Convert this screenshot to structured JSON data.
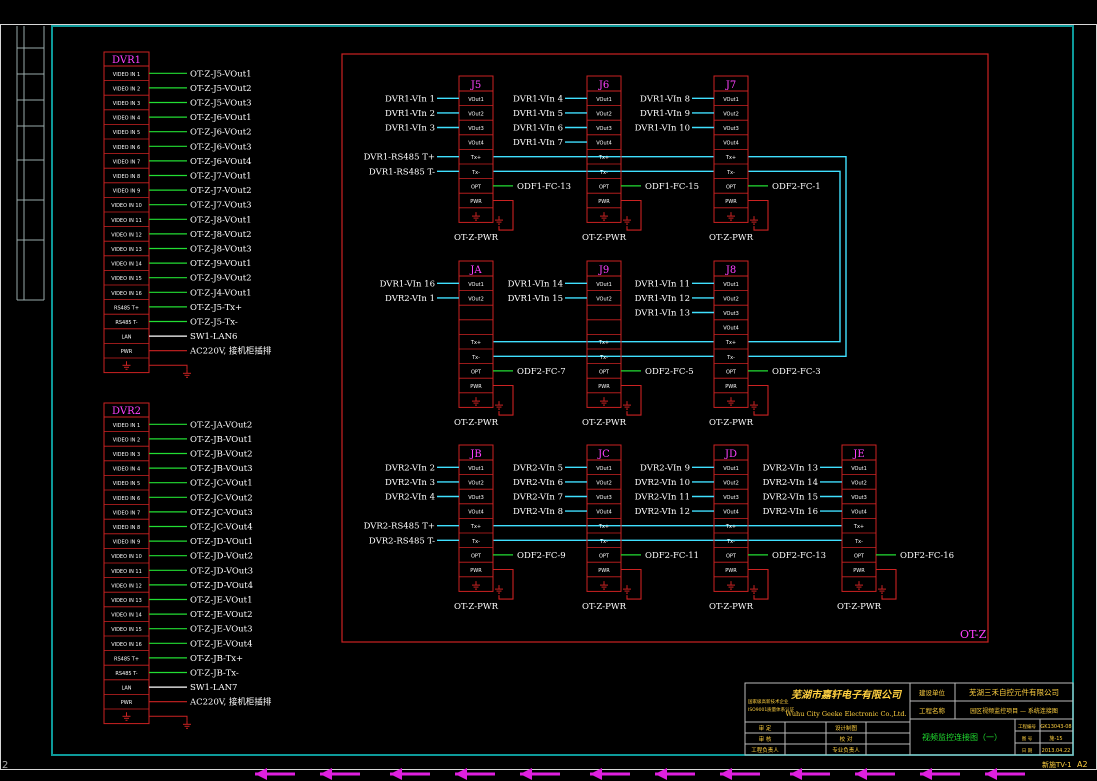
{
  "colors": {
    "background": "#000000",
    "frame": "#0d9a9a",
    "module": "#cc2222",
    "title": "#ff40ff",
    "label": "#ffffff",
    "wire_green": "#22dd33",
    "wire_cyan": "#40e0ff",
    "bottom_arrows": "#e020e0",
    "titleblock_text": "#ffd040",
    "titleblock_green": "#20dd30"
  },
  "zone_label": "OT-Z",
  "dvr_units": [
    {
      "title": "DVR1",
      "ports": [
        {
          "label": "VIDEO IN 1",
          "wire": "OT-Z-J5-VOut1",
          "wire_color": "green"
        },
        {
          "label": "VIDEO IN 2",
          "wire": "OT-Z-J5-VOut2",
          "wire_color": "green"
        },
        {
          "label": "VIDEO IN 3",
          "wire": "OT-Z-J5-VOut3",
          "wire_color": "green"
        },
        {
          "label": "VIDEO IN 4",
          "wire": "OT-Z-J6-VOut1",
          "wire_color": "green"
        },
        {
          "label": "VIDEO IN 5",
          "wire": "OT-Z-J6-VOut2",
          "wire_color": "green"
        },
        {
          "label": "VIDEO IN 6",
          "wire": "OT-Z-J6-VOut3",
          "wire_color": "green"
        },
        {
          "label": "VIDEO IN 7",
          "wire": "OT-Z-J6-VOut4",
          "wire_color": "green"
        },
        {
          "label": "VIDEO IN 8",
          "wire": "OT-Z-J7-VOut1",
          "wire_color": "green"
        },
        {
          "label": "VIDEO IN 9",
          "wire": "OT-Z-J7-VOut2",
          "wire_color": "green"
        },
        {
          "label": "VIDEO IN 10",
          "wire": "OT-Z-J7-VOut3",
          "wire_color": "green"
        },
        {
          "label": "VIDEO IN 11",
          "wire": "OT-Z-J8-VOut1",
          "wire_color": "green"
        },
        {
          "label": "VIDEO IN 12",
          "wire": "OT-Z-J8-VOut2",
          "wire_color": "green"
        },
        {
          "label": "VIDEO IN 13",
          "wire": "OT-Z-J8-VOut3",
          "wire_color": "green"
        },
        {
          "label": "VIDEO IN 14",
          "wire": "OT-Z-J9-VOut1",
          "wire_color": "green"
        },
        {
          "label": "VIDEO IN 15",
          "wire": "OT-Z-J9-VOut2",
          "wire_color": "green"
        },
        {
          "label": "VIDEO IN 16",
          "wire": "OT-Z-J4-VOut1",
          "wire_color": "green"
        },
        {
          "label": "RS485 T+",
          "wire": "OT-Z-J5-Tx+",
          "wire_color": "green"
        },
        {
          "label": "RS485 T-",
          "wire": "OT-Z-J5-Tx-",
          "wire_color": "green"
        },
        {
          "label": "LAN",
          "wire": "SW1-LAN6",
          "wire_color": "white"
        },
        {
          "label": "PWR",
          "wire": "AC220V, 接机柜插排",
          "wire_color": "red"
        },
        {
          "label": "",
          "wire": "",
          "wire_color": "ground"
        }
      ]
    },
    {
      "title": "DVR2",
      "ports": [
        {
          "label": "VIDEO IN 1",
          "wire": "OT-Z-JA-VOut2",
          "wire_color": "green"
        },
        {
          "label": "VIDEO IN 2",
          "wire": "OT-Z-JB-VOut1",
          "wire_color": "green"
        },
        {
          "label": "VIDEO IN 3",
          "wire": "OT-Z-JB-VOut2",
          "wire_color": "green"
        },
        {
          "label": "VIDEO IN 4",
          "wire": "OT-Z-JB-VOut3",
          "wire_color": "green"
        },
        {
          "label": "VIDEO IN 5",
          "wire": "OT-Z-JC-VOut1",
          "wire_color": "green"
        },
        {
          "label": "VIDEO IN 6",
          "wire": "OT-Z-JC-VOut2",
          "wire_color": "green"
        },
        {
          "label": "VIDEO IN 7",
          "wire": "OT-Z-JC-VOut3",
          "wire_color": "green"
        },
        {
          "label": "VIDEO IN 8",
          "wire": "OT-Z-JC-VOut4",
          "wire_color": "green"
        },
        {
          "label": "VIDEO IN 9",
          "wire": "OT-Z-JD-VOut1",
          "wire_color": "green"
        },
        {
          "label": "VIDEO IN 10",
          "wire": "OT-Z-JD-VOut2",
          "wire_color": "green"
        },
        {
          "label": "VIDEO IN 11",
          "wire": "OT-Z-JD-VOut3",
          "wire_color": "green"
        },
        {
          "label": "VIDEO IN 12",
          "wire": "OT-Z-JD-VOut4",
          "wire_color": "green"
        },
        {
          "label": "VIDEO IN 13",
          "wire": "OT-Z-JE-VOut1",
          "wire_color": "green"
        },
        {
          "label": "VIDEO IN 14",
          "wire": "OT-Z-JE-VOut2",
          "wire_color": "green"
        },
        {
          "label": "VIDEO IN 15",
          "wire": "OT-Z-JE-VOut3",
          "wire_color": "green"
        },
        {
          "label": "VIDEO IN 16",
          "wire": "OT-Z-JE-VOut4",
          "wire_color": "green"
        },
        {
          "label": "RS485 T+",
          "wire": "OT-Z-JB-Tx+",
          "wire_color": "green"
        },
        {
          "label": "RS485 T-",
          "wire": "OT-Z-JB-Tx-",
          "wire_color": "green"
        },
        {
          "label": "LAN",
          "wire": "SW1-LAN7",
          "wire_color": "white"
        },
        {
          "label": "PWR",
          "wire": "AC220V, 接机柜插排",
          "wire_color": "red"
        },
        {
          "label": "",
          "wire": "",
          "wire_color": "ground"
        }
      ]
    }
  ],
  "junction_boxes": [
    {
      "title": "J5",
      "ports": [
        "VOut1",
        "VOut2",
        "VOut3",
        "VOut4",
        "Tx+",
        "Tx-",
        "OPT",
        "PWR",
        ""
      ],
      "inputs": [
        "DVR1-VIn 1",
        "DVR1-VIn 2",
        "DVR1-VIn 3",
        "",
        "DVR1-RS485 T+",
        "DVR1-RS485 T-",
        "",
        "",
        ""
      ],
      "input_colors": [
        "cyan",
        "cyan",
        "cyan",
        "",
        "cyan",
        "cyan",
        "",
        "",
        ""
      ],
      "outputs": [
        "",
        "",
        "",
        "",
        "",
        "",
        "ODF1-FC-13",
        "",
        ""
      ],
      "power": "OT-Z-PWR"
    },
    {
      "title": "J6",
      "ports": [
        "VOut1",
        "VOut2",
        "VOut3",
        "VOut4",
        "Tx+",
        "Tx-",
        "OPT",
        "PWR",
        ""
      ],
      "inputs": [
        "DVR1-VIn 4",
        "DVR1-VIn 5",
        "DVR1-VIn 6",
        "DVR1-VIn 7",
        "",
        "",
        "",
        "",
        ""
      ],
      "input_colors": [
        "cyan",
        "cyan",
        "cyan",
        "cyan",
        "",
        "",
        "",
        "",
        ""
      ],
      "outputs": [
        "",
        "",
        "",
        "",
        "",
        "",
        "ODF1-FC-15",
        "",
        ""
      ],
      "power": "OT-Z-PWR"
    },
    {
      "title": "J7",
      "ports": [
        "VOut1",
        "VOut2",
        "VOut3",
        "VOut4",
        "Tx+",
        "Tx-",
        "OPT",
        "PWR",
        ""
      ],
      "inputs": [
        "DVR1-VIn 8",
        "DVR1-VIn 9",
        "DVR1-VIn 10",
        "",
        "",
        "",
        "",
        "",
        ""
      ],
      "input_colors": [
        "cyan",
        "cyan",
        "cyan",
        "",
        "",
        "",
        "",
        "",
        ""
      ],
      "outputs": [
        "",
        "",
        "",
        "",
        "",
        "",
        "ODF2-FC-1",
        "",
        ""
      ],
      "power": "OT-Z-PWR"
    },
    {
      "title": "JA",
      "ports": [
        "VOut1",
        "VOut2",
        "",
        "",
        "Tx+",
        "Tx-",
        "OPT",
        "PWR",
        ""
      ],
      "inputs": [
        "DVR1-VIn 16",
        "DVR2-VIn 1",
        "",
        "",
        "",
        "",
        "",
        "",
        ""
      ],
      "input_colors": [
        "cyan",
        "cyan",
        "",
        "",
        "",
        "",
        "",
        "",
        ""
      ],
      "outputs": [
        "",
        "",
        "",
        "",
        "",
        "",
        "ODF2-FC-7",
        "",
        ""
      ],
      "power": "OT-Z-PWR"
    },
    {
      "title": "J9",
      "ports": [
        "VOut1",
        "VOut2",
        "",
        "",
        "Tx+",
        "Tx-",
        "OPT",
        "PWR",
        ""
      ],
      "inputs": [
        "DVR1-VIn 14",
        "DVR1-VIn 15",
        "",
        "",
        "",
        "",
        "",
        "",
        ""
      ],
      "input_colors": [
        "cyan",
        "cyan",
        "",
        "",
        "",
        "",
        "",
        "",
        ""
      ],
      "outputs": [
        "",
        "",
        "",
        "",
        "",
        "",
        "ODF2-FC-5",
        "",
        ""
      ],
      "power": "OT-Z-PWR"
    },
    {
      "title": "J8",
      "ports": [
        "VOut1",
        "VOut2",
        "VOut3",
        "VOut4",
        "Tx+",
        "Tx-",
        "OPT",
        "PWR",
        ""
      ],
      "inputs": [
        "DVR1-VIn 11",
        "DVR1-VIn 12",
        "DVR1-VIn 13",
        "",
        "",
        "",
        "",
        "",
        ""
      ],
      "input_colors": [
        "cyan",
        "cyan",
        "cyan",
        "",
        "",
        "",
        "",
        "",
        ""
      ],
      "outputs": [
        "",
        "",
        "",
        "",
        "",
        "",
        "ODF2-FC-3",
        "",
        ""
      ],
      "power": "OT-Z-PWR"
    },
    {
      "title": "JB",
      "ports": [
        "VOut1",
        "VOut2",
        "VOut3",
        "VOut4",
        "Tx+",
        "Tx-",
        "OPT",
        "PWR",
        ""
      ],
      "inputs": [
        "DVR2-VIn 2",
        "DVR2-VIn 3",
        "DVR2-VIn 4",
        "",
        "DVR2-RS485 T+",
        "DVR2-RS485 T-",
        "",
        "",
        ""
      ],
      "input_colors": [
        "cyan",
        "cyan",
        "cyan",
        "",
        "cyan",
        "cyan",
        "",
        "",
        ""
      ],
      "outputs": [
        "",
        "",
        "",
        "",
        "",
        "",
        "ODF2-FC-9",
        "",
        ""
      ],
      "power": "OT-Z-PWR"
    },
    {
      "title": "JC",
      "ports": [
        "VOut1",
        "VOut2",
        "VOut3",
        "VOut4",
        "Tx+",
        "Tx-",
        "OPT",
        "PWR",
        ""
      ],
      "inputs": [
        "DVR2-VIn 5",
        "DVR2-VIn 6",
        "DVR2-VIn 7",
        "DVR2-VIn 8",
        "",
        "",
        "",
        "",
        ""
      ],
      "input_colors": [
        "cyan",
        "cyan",
        "cyan",
        "cyan",
        "",
        "",
        "",
        "",
        ""
      ],
      "outputs": [
        "",
        "",
        "",
        "",
        "",
        "",
        "ODF2-FC-11",
        "",
        ""
      ],
      "power": "OT-Z-PWR"
    },
    {
      "title": "JD",
      "ports": [
        "VOut1",
        "VOut2",
        "VOut3",
        "VOut4",
        "Tx+",
        "Tx-",
        "OPT",
        "PWR",
        ""
      ],
      "inputs": [
        "DVR2-VIn 9",
        "DVR2-VIn 10",
        "DVR2-VIn 11",
        "DVR2-VIn 12",
        "",
        "",
        "",
        "",
        ""
      ],
      "input_colors": [
        "cyan",
        "cyan",
        "cyan",
        "cyan",
        "",
        "",
        "",
        "",
        ""
      ],
      "outputs": [
        "",
        "",
        "",
        "",
        "",
        "",
        "ODF2-FC-13",
        "",
        ""
      ],
      "power": "OT-Z-PWR"
    },
    {
      "title": "JE",
      "ports": [
        "VOut1",
        "VOut2",
        "VOut3",
        "VOut4",
        "Tx+",
        "Tx-",
        "OPT",
        "PWR",
        ""
      ],
      "inputs": [
        "DVR2-VIn 13",
        "DVR2-VIn 14",
        "DVR2-VIn 15",
        "DVR2-VIn 16",
        "",
        "",
        "",
        "",
        ""
      ],
      "input_colors": [
        "cyan",
        "cyan",
        "cyan",
        "cyan",
        "",
        "",
        "",
        "",
        ""
      ],
      "outputs": [
        "",
        "",
        "",
        "",
        "",
        "",
        "ODF2-FC-16",
        "",
        ""
      ],
      "power": "OT-Z-PWR"
    }
  ],
  "title_block": {
    "company_cn": "芜湖市嘉轩电子有限公司",
    "company_en": "Wuhu City Geeke Electronic Co.,Ltd.",
    "left_note_1": "国家级高新技术企业",
    "left_note_2": "ISO9001质量体系认证",
    "rows_left": [
      [
        "审  定",
        ""
      ],
      [
        "审  核",
        ""
      ],
      [
        "工程负责人",
        ""
      ]
    ],
    "rows_mid": [
      [
        "设计制图",
        ""
      ],
      [
        "校  对",
        ""
      ],
      [
        "专业负责人",
        ""
      ]
    ],
    "construction_unit_label": "建设单位",
    "construction_unit": "芜湖三禾自控元件有限公司",
    "project_label": "工程名称",
    "project": "园区视频监控项目 — 系统连接图",
    "drawing_title": "视频监控连接图（一）",
    "project_no_label": "工程编号",
    "project_no": "GK13043-08",
    "drawing_no_label": "图    号",
    "drawing_no": "施-15",
    "date_label": "日    期",
    "date": "2013.04.22",
    "sheet": "新施TV-1",
    "paper": "A2"
  },
  "left_margin_marker": "2"
}
